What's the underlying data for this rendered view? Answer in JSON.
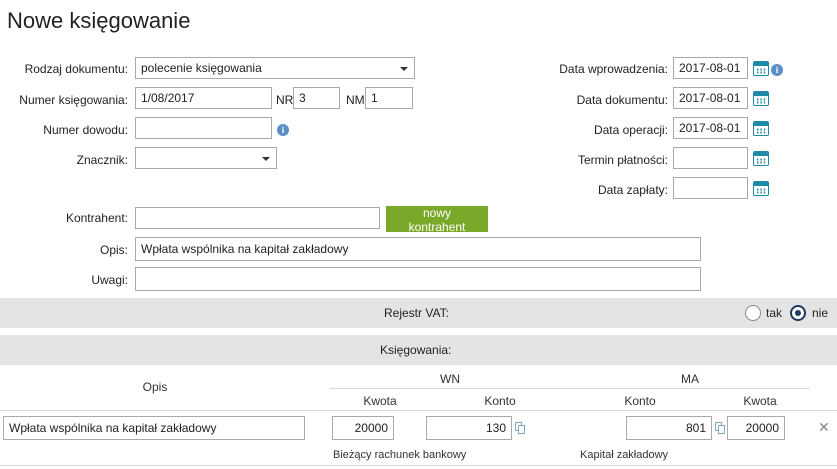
{
  "page": {
    "title": "Nowe księgowanie"
  },
  "form": {
    "rodzaj_label": "Rodzaj dokumentu:",
    "rodzaj_value": "polecenie księgowania",
    "numer_label": "Numer księgowania:",
    "numer_value": "1/08/2017",
    "nr_label": "NR:",
    "nr_value": "3",
    "nm_label": "NM:",
    "nm_value": "1",
    "dowod_label": "Numer dowodu:",
    "dowod_value": "",
    "znacznik_label": "Znacznik:",
    "znacznik_value": "",
    "kontrahent_label": "Kontrahent:",
    "kontrahent_value": "",
    "nowy_kontrahent_button": "nowy kontrahent",
    "opis_label": "Opis:",
    "opis_value": "Wpłata wspólnika na kapitał zakładowy",
    "uwagi_label": "Uwagi:",
    "uwagi_value": ""
  },
  "dates": {
    "wprowadzenia_label": "Data wprowadzenia:",
    "wprowadzenia_value": "2017-08-01",
    "dokumentu_label": "Data dokumentu:",
    "dokumentu_value": "2017-08-01",
    "operacji_label": "Data operacji:",
    "operacji_value": "2017-08-01",
    "termin_label": "Termin płatności:",
    "termin_value": "",
    "zaplaty_label": "Data zapłaty:",
    "zaplaty_value": ""
  },
  "vat": {
    "label": "Rejestr VAT:",
    "option_yes": "tak",
    "option_no": "nie",
    "selected": "nie"
  },
  "postings": {
    "section_label": "Księgowania:",
    "col_opis": "Opis",
    "col_wn": "WN",
    "col_ma": "MA",
    "col_kwota": "Kwota",
    "col_konto": "Konto",
    "rows": [
      {
        "opis": "Wpłata wspólnika na kapitał zakładowy",
        "wn_kwota": "20000",
        "wn_konto": "130",
        "ma_konto": "801",
        "ma_kwota": "20000",
        "wn_konto_name": "Bieżący rachunek bankowy",
        "ma_konto_name": "Kapitał zakładowy"
      }
    ]
  },
  "icons": {
    "calendar": "calendar-icon",
    "info": "info-icon",
    "info_glyph": "i",
    "copy": "copy-icon",
    "close": "close-icon",
    "close_glyph": "✕"
  },
  "colors": {
    "accent_green": "#7aa92a",
    "calendar_blue": "#1f8aa8",
    "band_gray": "#e4e4e4"
  }
}
